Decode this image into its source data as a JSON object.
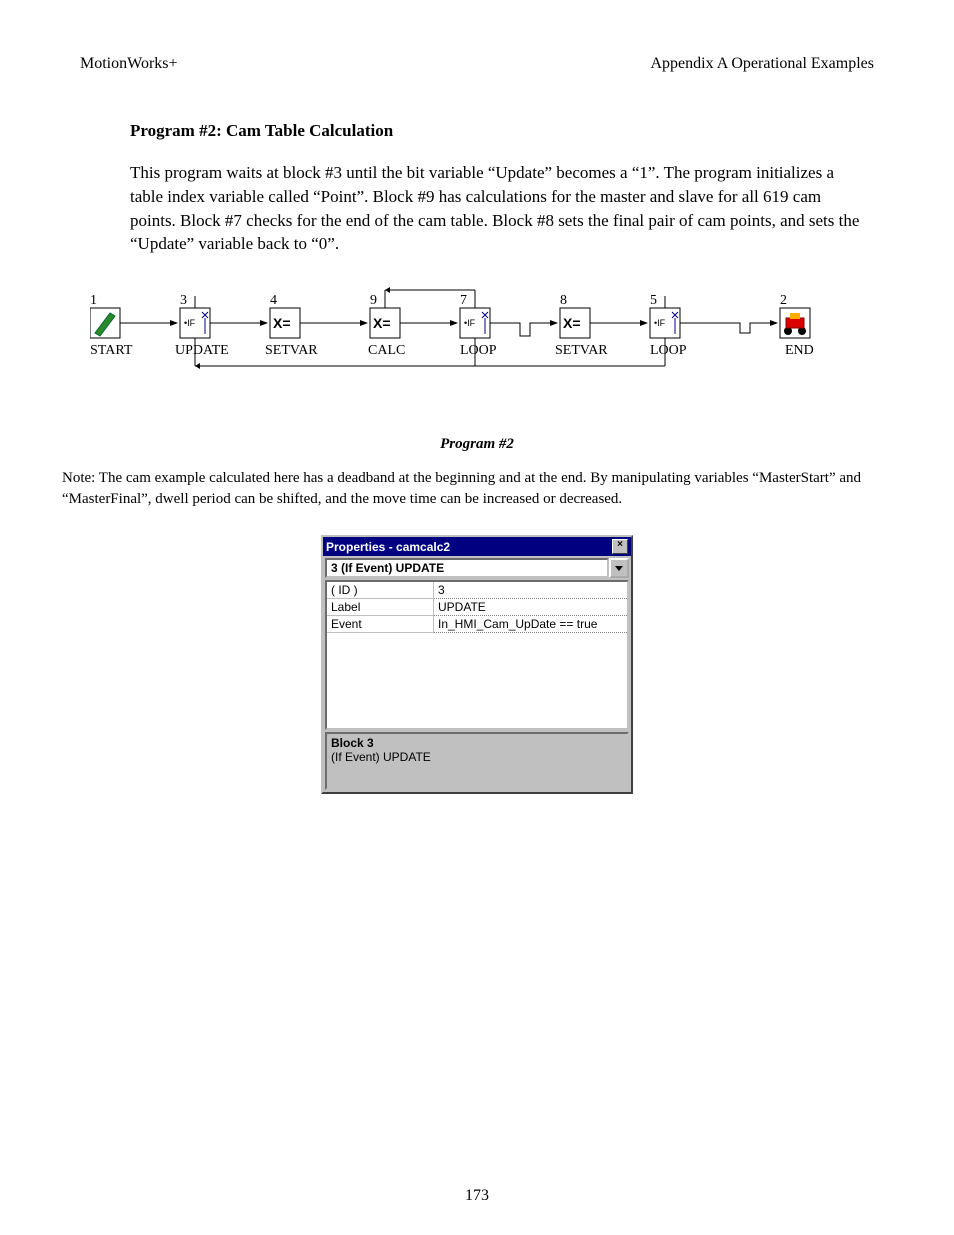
{
  "header": {
    "left": "MotionWorks+",
    "right": "Appendix A    Operational Examples"
  },
  "section_title": "Program #2: Cam Table Calculation",
  "body_text": "This program waits at block #3 until the bit variable “Update” becomes a “1”.  The program initializes a table index variable called “Point”.  Block #9 has calculations for the master and slave for all 619 cam points.  Block #7 checks for the end of the cam table.  Block #8 sets the final pair of cam points, and sets the “Update” variable back to “0”.",
  "diagram": {
    "blocks": [
      {
        "num": "1",
        "label": "START",
        "type": "start"
      },
      {
        "num": "3",
        "label": "UPDATE",
        "type": "if"
      },
      {
        "num": "4",
        "label": "SETVAR",
        "type": "assign"
      },
      {
        "num": "9",
        "label": "CALC",
        "type": "assign"
      },
      {
        "num": "7",
        "label": "LOOP",
        "type": "if"
      },
      {
        "num": "8",
        "label": "SETVAR",
        "type": "assign"
      },
      {
        "num": "5",
        "label": "LOOP",
        "type": "if"
      },
      {
        "num": "2",
        "label": "END",
        "type": "end"
      }
    ]
  },
  "caption": "Program #2",
  "note": "Note: The cam example calculated here has a deadband at the beginning and at the end.  By manipulating variables “MasterStart” and “MasterFinal”, dwell period can be shifted, and the move time can be increased or decreased.",
  "properties": {
    "title": "Properties - camcalc2",
    "dropdown": "3 (If Event) UPDATE",
    "rows": [
      {
        "label": "( ID )",
        "value": "3"
      },
      {
        "label": "Label",
        "value": "UPDATE"
      },
      {
        "label": "Event",
        "value": "In_HMI_Cam_UpDate == true"
      }
    ],
    "footer_title": "Block 3",
    "footer_sub": "(If Event) UPDATE"
  },
  "page_number": "173"
}
